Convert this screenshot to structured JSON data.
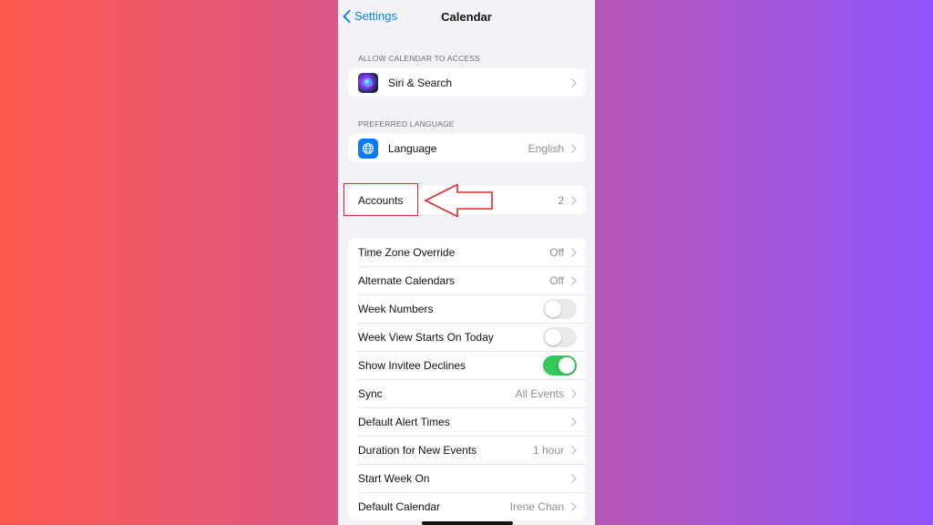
{
  "nav": {
    "back_label": "Settings",
    "title": "Calendar"
  },
  "access_section": {
    "header": "ALLOW CALENDAR TO ACCESS",
    "items": [
      {
        "label": "Siri & Search",
        "icon": "siri-icon"
      }
    ]
  },
  "language_section": {
    "header": "PREFERRED LANGUAGE",
    "items": [
      {
        "label": "Language",
        "value": "English",
        "icon": "globe-icon"
      }
    ]
  },
  "accounts": {
    "label": "Accounts",
    "value": "2"
  },
  "settings_list": {
    "items": [
      {
        "label": "Time Zone Override",
        "value": "Off",
        "type": "chevron"
      },
      {
        "label": "Alternate Calendars",
        "value": "Off",
        "type": "chevron"
      },
      {
        "label": "Week Numbers",
        "type": "toggle",
        "state": "off"
      },
      {
        "label": "Week View Starts On Today",
        "type": "toggle",
        "state": "off"
      },
      {
        "label": "Show Invitee Declines",
        "type": "toggle",
        "state": "on"
      },
      {
        "label": "Sync",
        "value": "All Events",
        "type": "chevron"
      },
      {
        "label": "Default Alert Times",
        "value": "",
        "type": "chevron"
      },
      {
        "label": "Duration for New Events",
        "value": "1 hour",
        "type": "chevron"
      },
      {
        "label": "Start Week On",
        "value": "",
        "type": "chevron"
      },
      {
        "label": "Default Calendar",
        "value": "Irene Chan",
        "type": "chevron"
      }
    ]
  },
  "colors": {
    "accent": "#0a84ff",
    "toggle_on": "#34c759",
    "annotation": "#e3262b",
    "background_left": "#fe5a4f",
    "background_right": "#8f55fb"
  }
}
